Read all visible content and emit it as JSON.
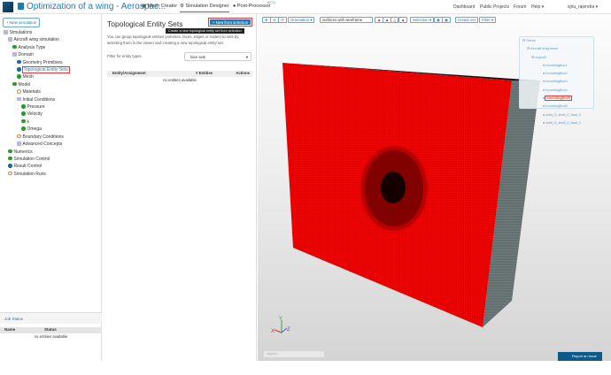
{
  "header": {
    "title": "Optimization of a wing - Aerospac...",
    "nav": [
      {
        "label": "Mesh Creator",
        "icon": "grid-icon"
      },
      {
        "label": "Simulation Designer",
        "icon": "gears-icon",
        "active": true
      },
      {
        "label": "Post-Processor",
        "icon": "circle-icon",
        "badge": "BETA"
      }
    ],
    "right": [
      "Dashboard",
      "Public Projects",
      "Forum",
      "Help ▾",
      "sjnu_rajendra ▾"
    ]
  },
  "sidebar": {
    "new_simulation": "+ New simulation",
    "tree": [
      {
        "label": "Simulations",
        "level": 0,
        "icon": "sq"
      },
      {
        "label": "Aircraft wing simulation",
        "level": 1,
        "icon": "sq"
      },
      {
        "label": "Analysis Type",
        "level": 2,
        "icon": "g"
      },
      {
        "label": "Domain",
        "level": 2,
        "icon": "sq"
      },
      {
        "label": "Geometry Primitives",
        "level": 3,
        "icon": "b"
      },
      {
        "label": "Topological Entity Sets",
        "level": 3,
        "icon": "b",
        "selected": true
      },
      {
        "label": "Mesh",
        "level": 3,
        "icon": "g"
      },
      {
        "label": "Model",
        "level": 2,
        "icon": "g"
      },
      {
        "label": "Materials",
        "level": 3,
        "icon": "o"
      },
      {
        "label": "Initial Conditions",
        "level": 3,
        "icon": "sq"
      },
      {
        "label": "Pressure",
        "level": 4,
        "icon": "g"
      },
      {
        "label": "Velocity",
        "level": 4,
        "icon": "g"
      },
      {
        "label": "k",
        "level": 4,
        "icon": "g"
      },
      {
        "label": "Omega",
        "level": 4,
        "icon": "g"
      },
      {
        "label": "Boundary Conditions",
        "level": 3,
        "icon": "o"
      },
      {
        "label": "Advanced Concepts",
        "level": 3,
        "icon": "sq"
      },
      {
        "label": "Numerics",
        "level": 1,
        "icon": "g"
      },
      {
        "label": "Simulation Control",
        "level": 1,
        "icon": "g"
      },
      {
        "label": "Result Control",
        "level": 1,
        "icon": "b"
      },
      {
        "label": "Simulation Runs",
        "level": 1,
        "icon": "o"
      }
    ]
  },
  "job_status": {
    "title": "Job Status",
    "columns": [
      "Name",
      "Status"
    ],
    "empty": "no entities available"
  },
  "panel": {
    "title": "Topological Entity Sets",
    "new_button": "+ New from selection",
    "tooltip": "Create a new topological entity set from selection",
    "description": "You can group topological entities (volumes, faces, edges or nodes) to sets by selecting them in the viewer and creating a new topological entity set.",
    "filter_label": "Filter for entity types",
    "filter_value": "face sets",
    "columns": [
      "Entity/Assignment",
      "# Entities",
      "Actions"
    ],
    "empty": "no entities available"
  },
  "viewer": {
    "toolbar": {
      "orientation": "Orientation ▾",
      "render_mode": "surfaces with wireframe",
      "selection": "Selection ▾",
      "create_set": "Create set",
      "filter": "Filter ▾"
    },
    "scene_tree": [
      {
        "label": "Scene",
        "level": 0
      },
      {
        "label": "Aircraft wing mesh",
        "level": 1
      },
      {
        "label": "region0",
        "level": 2
      },
      {
        "label": "boundingBox1",
        "level": 3
      },
      {
        "label": "boundingBox2",
        "level": 3
      },
      {
        "label": "boundingBox3",
        "level": 3
      },
      {
        "label": "boundingBox4",
        "level": 3
      },
      {
        "label": "boundingBox5",
        "level": 3,
        "selected": true
      },
      {
        "label": "boundingBox6",
        "level": 3
      },
      {
        "label": "solid_0_shell_0_face_0",
        "level": 3
      },
      {
        "label": "solid_0_shell_0_face_1",
        "level": 3
      }
    ],
    "axes": [
      "X",
      "Y",
      "Z"
    ],
    "region_input": "region0",
    "report": "Report an issue",
    "mesh_color": "#ff0000",
    "selected_color": "#e8602c"
  }
}
